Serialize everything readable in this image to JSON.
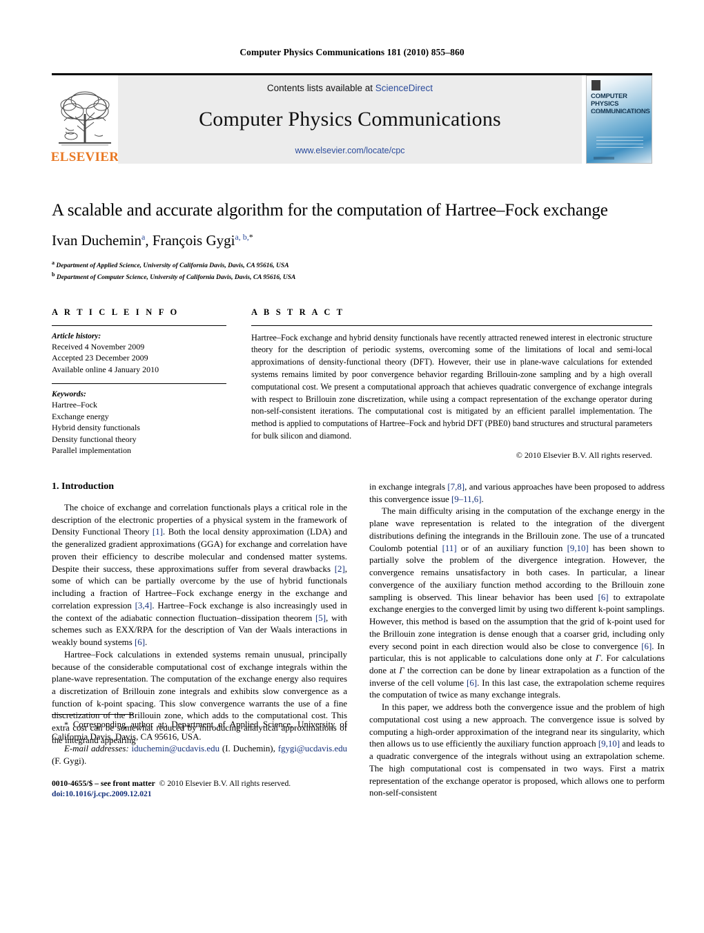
{
  "running_head": "Computer Physics Communications 181 (2010) 855–860",
  "masthead": {
    "elsevier_wordmark": "ELSEVIER",
    "contents_prefix": "Contents lists available at",
    "sciencedirect": "ScienceDirect",
    "journal_name": "Computer Physics Communications",
    "journal_url": "www.elsevier.com/locate/cpc",
    "cover_title": "COMPUTER PHYSICS COMMUNICATIONS",
    "link_color": "#2b4b9b",
    "elsevier_orange": "#E87722"
  },
  "article": {
    "title": "A scalable and accurate algorithm for the computation of Hartree–Fock exchange",
    "authors_plain": "Ivan Duchemin, François Gygi",
    "author_1_name": "Ivan Duchemin",
    "author_1_sup": "a",
    "author_2_name": "François Gygi",
    "author_2_sup": "a, b,",
    "author_2_star": "*",
    "affiliation_a_sup": "a",
    "affiliation_a": "Department of Applied Science, University of California Davis, Davis, CA 95616, USA",
    "affiliation_b_sup": "b",
    "affiliation_b": "Department of Computer Science, University of California Davis, Davis, CA 95616, USA"
  },
  "article_info": {
    "heading": "A R T I C L E    I N F O",
    "history_label": "Article history:",
    "history": [
      "Received 4 November 2009",
      "Accepted 23 December 2009",
      "Available online 4 January 2010"
    ],
    "keywords_label": "Keywords:",
    "keywords": [
      "Hartree–Fock",
      "Exchange energy",
      "Hybrid density functionals",
      "Density functional theory",
      "Parallel implementation"
    ]
  },
  "abstract": {
    "heading": "A B S T R A C T",
    "text": "Hartree–Fock exchange and hybrid density functionals have recently attracted renewed interest in electronic structure theory for the description of periodic systems, overcoming some of the limitations of local and semi-local approximations of density-functional theory (DFT). However, their use in plane-wave calculations for extended systems remains limited by poor convergence behavior regarding Brillouin-zone sampling and by a high overall computational cost. We present a computational approach that achieves quadratic convergence of exchange integrals with respect to Brillouin zone discretization, while using a compact representation of the exchange operator during non-self-consistent iterations. The computational cost is mitigated by an efficient parallel implementation. The method is applied to computations of Hartree–Fock and hybrid DFT (PBE0) band structures and structural parameters for bulk silicon and diamond.",
    "copyright": "© 2010 Elsevier B.V. All rights reserved."
  },
  "body": {
    "section_number_title": "1. Introduction",
    "left_paragraph_1_a": "The choice of exchange and correlation functionals plays a critical role in the description of the electronic properties of a physical system in the framework of Density Functional Theory ",
    "left_paragraph_1_ref1": "[1]",
    "left_paragraph_1_b": ". Both the local density approximation (LDA) and the generalized gradient approximations (GGA) for exchange and correlation have proven their efficiency to describe molecular and condensed matter systems. Despite their success, these approximations suffer from several drawbacks ",
    "left_paragraph_1_ref2": "[2]",
    "left_paragraph_1_c": ", some of which can be partially overcome by the use of hybrid functionals including a fraction of Hartree–Fock exchange energy in the exchange and correlation expression ",
    "left_paragraph_1_ref3": "[3,4]",
    "left_paragraph_1_d": ". Hartree–Fock exchange is also increasingly used in the context of the adiabatic connection fluctuation–dissipation theorem ",
    "left_paragraph_1_ref4": "[5]",
    "left_paragraph_1_e": ", with schemes such as EXX/RPA for the description of Van der Waals interactions in weakly bound systems ",
    "left_paragraph_1_ref5": "[6]",
    "left_paragraph_1_f": ".",
    "left_paragraph_2": "Hartree–Fock calculations in extended systems remain unusual, principally because of the considerable computational cost of exchange integrals within the plane-wave representation. The computation of the exchange energy also requires a discretization of Brillouin zone integrals and exhibits slow convergence as a function of k-point spacing. This slow convergence warrants the use of a fine discretization of the Brillouin zone, which adds to the computational cost. This extra cost can be somewhat reduced by introducing analytical approximations of the integrand appearing",
    "right_paragraph_1_a": "in exchange integrals ",
    "right_paragraph_1_ref1": "[7,8]",
    "right_paragraph_1_b": ", and various approaches have been proposed to address this convergence issue ",
    "right_paragraph_1_ref2": "[9–11,6]",
    "right_paragraph_1_c": ".",
    "right_paragraph_2_a": "The main difficulty arising in the computation of the exchange energy in the plane wave representation is related to the integration of the divergent distributions defining the integrands in the Brillouin zone. The use of a truncated Coulomb potential ",
    "right_paragraph_2_ref1": "[11]",
    "right_paragraph_2_b": " or of an auxiliary function ",
    "right_paragraph_2_ref2": "[9,10]",
    "right_paragraph_2_c": " has been shown to partially solve the problem of the divergence integration. However, the convergence remains unsatisfactory in both cases. In particular, a linear convergence of the auxiliary function method according to the Brillouin zone sampling is observed. This linear behavior has been used ",
    "right_paragraph_2_ref3": "[6]",
    "right_paragraph_2_d": " to extrapolate exchange energies to the converged limit by using two different k-point samplings. However, this method is based on the assumption that the grid of k-point used for the Brillouin zone integration is dense enough that a coarser grid, including only every second point in each direction would also be close to convergence ",
    "right_paragraph_2_ref4": "[6]",
    "right_paragraph_2_e": ". In particular, this is not applicable to calculations done only at ",
    "right_paragraph_2_gamma1": "Γ",
    "right_paragraph_2_f": ". For calculations done at ",
    "right_paragraph_2_gamma2": "Γ",
    "right_paragraph_2_g": " the correction can be done by linear extrapolation as a function of the inverse of the cell volume ",
    "right_paragraph_2_ref5": "[6]",
    "right_paragraph_2_h": ". In this last case, the extrapolation scheme requires the computation of twice as many exchange integrals.",
    "right_paragraph_3_a": "In this paper, we address both the convergence issue and the problem of high computational cost using a new approach. The convergence issue is solved by computing a high-order approximation of the integrand near its singularity, which then allows us to use efficiently the auxiliary function approach ",
    "right_paragraph_3_ref1": "[9,10]",
    "right_paragraph_3_b": " and leads to a quadratic convergence of the integrals without using an extrapolation scheme. The high computational cost is compensated in two ways. First a matrix representation of the exchange operator is proposed, which allows one to perform non-self-consistent"
  },
  "footnotes": {
    "star": "*",
    "corresponding_text": "Corresponding author at: Department of Applied Science, University of California Davis, Davis, CA 95616, USA.",
    "email_label": "E-mail addresses:",
    "email_1": "iduchemin@ucdavis.edu",
    "email_1_owner": "(I. Duchemin),",
    "email_2": "fgygi@ucdavis.edu",
    "email_2_owner": "(F. Gygi).",
    "issn_line": "0010-4655/$ – see front matter",
    "issn_copyright": "© 2010 Elsevier B.V. All rights reserved.",
    "doi": "doi:10.1016/j.cpc.2009.12.021"
  }
}
